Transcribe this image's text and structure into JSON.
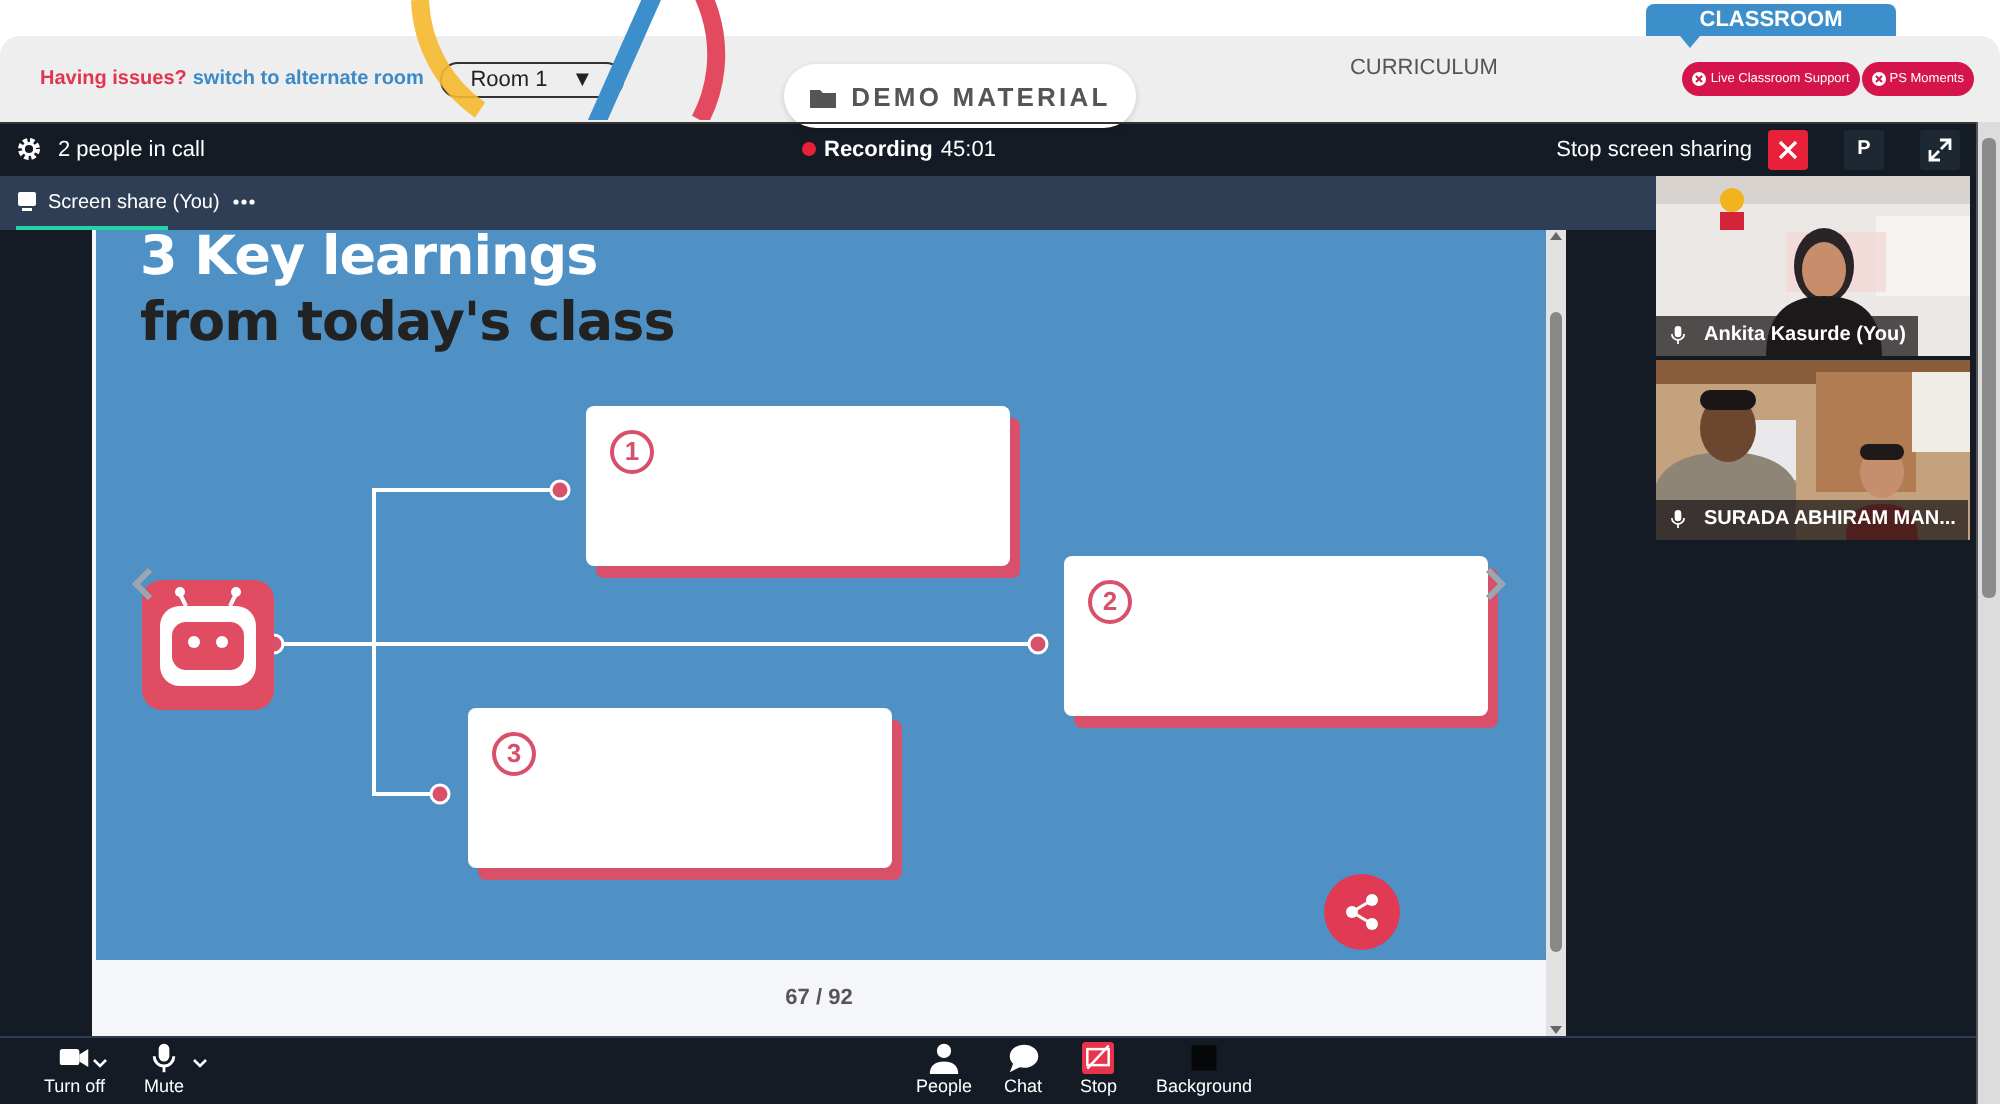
{
  "header": {
    "help_prompt": "Having issues?",
    "help_link": "switch to alternate room",
    "room_select": {
      "value": "Room 1",
      "arrow": "▼"
    },
    "nav": [
      {
        "label": "DEMO MATERIAL",
        "kind": "pill"
      },
      {
        "label": "CURRICULUM",
        "kind": "plain"
      },
      {
        "label": "CLASSROOM",
        "kind": "tab"
      }
    ],
    "buttons": [
      "Live Classroom Support",
      "PS Moments"
    ]
  },
  "call": {
    "participants": "2 people in call",
    "recording": {
      "label": "Recording",
      "time": "45:01"
    },
    "stop_share": "Stop screen sharing",
    "p_button": "P",
    "share_tab": "Screen share (You)"
  },
  "slide": {
    "title_lines": [
      "3 Key learnings",
      "from today's class"
    ],
    "boxes": [
      {
        "number": "1"
      },
      {
        "number": "2"
      },
      {
        "number": "3"
      }
    ],
    "page": "67 / 92"
  },
  "participants": [
    {
      "name": "Ankita Kasurde (You)"
    },
    {
      "name": "SURADA ABHIRAM MAN..."
    }
  ],
  "toolbar": [
    {
      "label": "Turn off",
      "kind": "camera"
    },
    {
      "label": "Mute",
      "kind": "mic"
    },
    {
      "label": "People",
      "kind": "people"
    },
    {
      "label": "Chat",
      "kind": "chat"
    },
    {
      "label": "Stop",
      "kind": "share"
    },
    {
      "label": "Background",
      "kind": "background"
    }
  ]
}
